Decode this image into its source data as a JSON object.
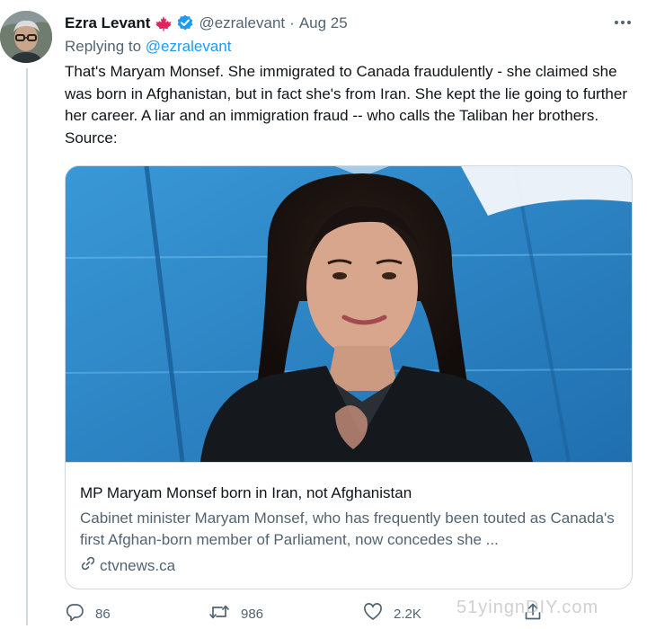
{
  "tweet": {
    "author_name": "Ezra Levant",
    "author_handle": "@ezralevant",
    "separator": "·",
    "date": "Aug 25",
    "replying_prefix": "Replying to ",
    "replying_to": "@ezralevant",
    "text": "That's Maryam Monsef. She immigrated to Canada fraudulently - she claimed she was born in Afghanistan, but in fact she's from Iran. She kept the lie going to further her career. A liar and an immigration fraud -- who calls the Taliban her brothers. Source:"
  },
  "icons": {
    "flag": "maple-leaf-icon",
    "verified": "verified-badge-icon",
    "more": "more-icon",
    "link": "link-icon",
    "reply": "reply-icon",
    "retweet": "retweet-icon",
    "like": "like-icon",
    "share": "share-icon"
  },
  "card": {
    "title": "MP Maryam Monsef born in Iran, not Afghanistan",
    "description": "Cabinet minister Maryam Monsef, who has frequently been touted as Canada's first Afghan-born member of Parliament, now concedes she ...",
    "domain": "ctvnews.ca"
  },
  "actions": {
    "replies": "86",
    "retweets": "986",
    "likes": "2.2K"
  },
  "watermark": "51yingnDIY.com",
  "colors": {
    "link": "#1d9bf0",
    "secondary": "#536471",
    "border": "#cfd9de",
    "flag_red": "#e0245e",
    "image_background": "#2e88c9"
  }
}
